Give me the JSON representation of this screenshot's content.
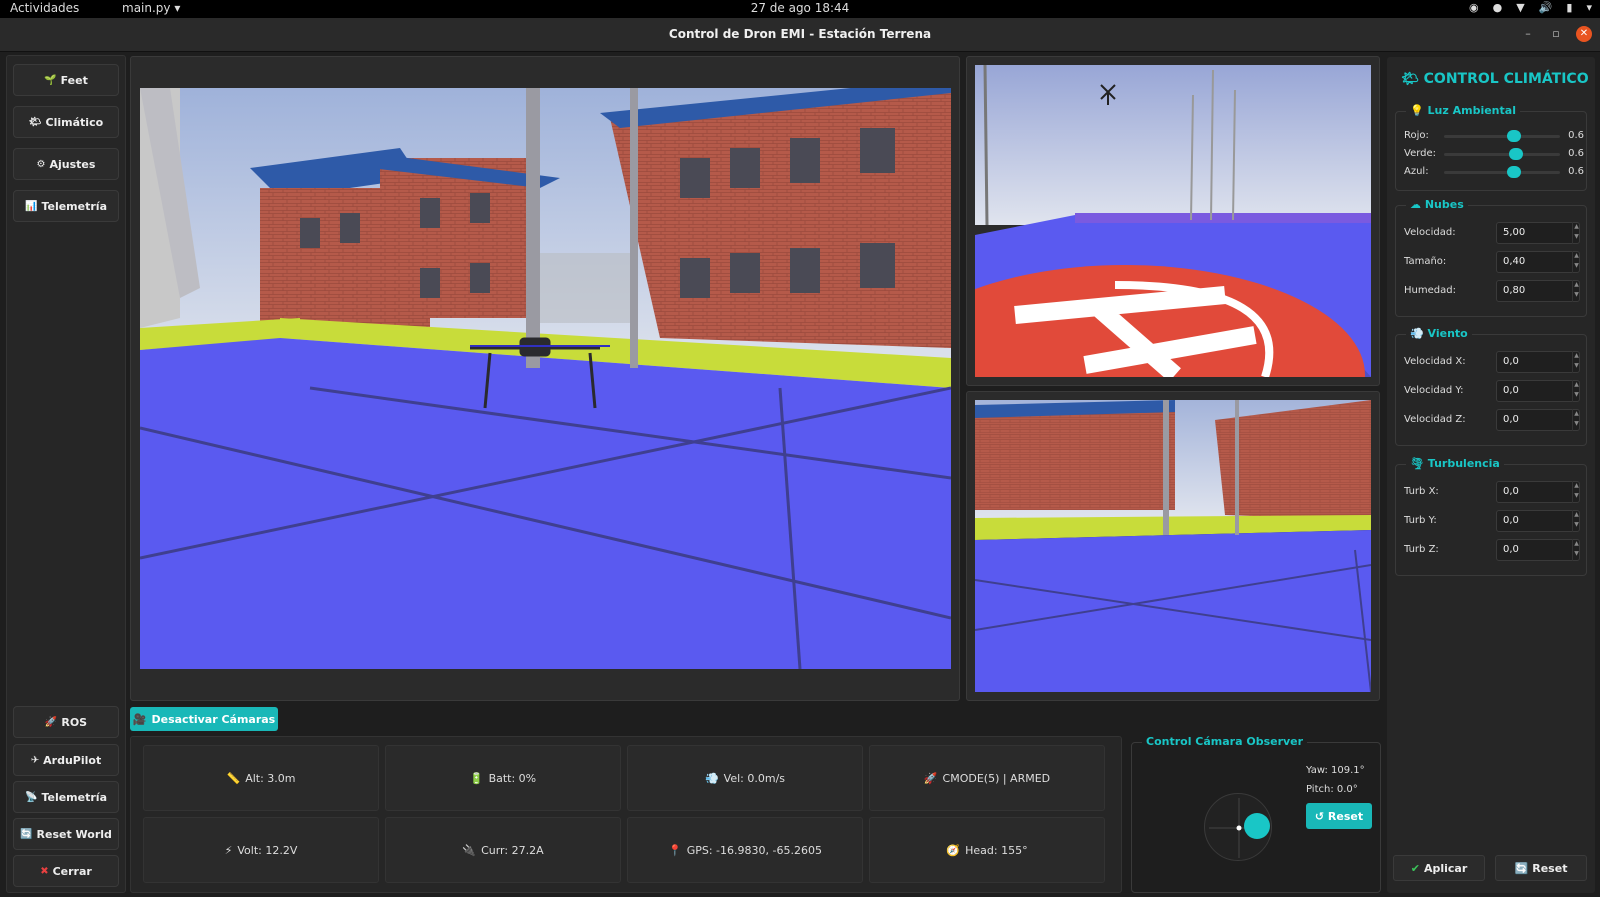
{
  "system_bar": {
    "activities": "Actividades",
    "app_menu": "main.py ▾",
    "clock": "27 de ago  18:44"
  },
  "window": {
    "title": "Control de Dron EMI - Estación Terrena"
  },
  "left_nav": {
    "top": [
      {
        "icon": "leaf-icon",
        "glyph": "🌱",
        "label": "Feet"
      },
      {
        "icon": "weather-icon",
        "glyph": "🌤",
        "label": "Climático"
      },
      {
        "icon": "gear-icon",
        "glyph": "⚙",
        "label": "Ajustes"
      },
      {
        "icon": "chart-icon",
        "glyph": "📊",
        "label": "Telemetría"
      }
    ],
    "bottom": [
      {
        "icon": "rocket-icon",
        "glyph": "🚀",
        "label": "ROS"
      },
      {
        "icon": "plane-icon",
        "glyph": "✈",
        "label": "ArduPilot"
      },
      {
        "icon": "satellite-icon",
        "glyph": "📡",
        "label": "Telemetría"
      },
      {
        "icon": "reset-icon",
        "glyph": "🔄",
        "label": "Reset World"
      },
      {
        "icon": "close-icon",
        "glyph": "✖",
        "label": "Cerrar"
      }
    ]
  },
  "cameras": {
    "toggle_label": "Desactivar Cámaras"
  },
  "telemetry": {
    "row1": [
      {
        "icon": "altitude-icon",
        "glyph": "📏",
        "text": "Alt: 3.0m"
      },
      {
        "icon": "battery-icon",
        "glyph": "🔋",
        "text": "Batt: 0%"
      },
      {
        "icon": "wind-icon",
        "glyph": "💨",
        "text": "Vel: 0.0m/s"
      },
      {
        "icon": "mode-icon",
        "glyph": "🚀",
        "text": "CMODE(5) | ARMED"
      }
    ],
    "row2": [
      {
        "icon": "bolt-icon",
        "glyph": "⚡",
        "text": "Volt: 12.2V"
      },
      {
        "icon": "plug-icon",
        "glyph": "🔌",
        "text": "Curr: 27.2A"
      },
      {
        "icon": "pin-icon",
        "glyph": "📍",
        "text": "GPS: -16.9830, -65.2605"
      },
      {
        "icon": "compass-icon",
        "glyph": "🧭",
        "text": "Head: 155°"
      }
    ]
  },
  "observer": {
    "title": "Control Cámara Observer",
    "yaw": "Yaw: 109.1°",
    "pitch": "Pitch: 0.0°",
    "reset_label": "↺ Reset"
  },
  "climate": {
    "title": "CONTROL CLIMÁTICO",
    "light": {
      "title": "Luz Ambiental",
      "sliders": [
        {
          "label": "Rojo:",
          "value": "0.6",
          "fraction": 0.6
        },
        {
          "label": "Verde:",
          "value": "0.6",
          "fraction": 0.62
        },
        {
          "label": "Azul:",
          "value": "0.6",
          "fraction": 0.6
        }
      ]
    },
    "clouds": {
      "title": "Nubes",
      "fields": [
        {
          "label": "Velocidad:",
          "value": "5,00"
        },
        {
          "label": "Tamaño:",
          "value": "0,40"
        },
        {
          "label": "Humedad:",
          "value": "0,80"
        }
      ]
    },
    "wind": {
      "title": "Viento",
      "fields": [
        {
          "label": "Velocidad X:",
          "value": "0,0"
        },
        {
          "label": "Velocidad Y:",
          "value": "0,0"
        },
        {
          "label": "Velocidad Z:",
          "value": "0,0"
        }
      ]
    },
    "turbulence": {
      "title": "Turbulencia",
      "fields": [
        {
          "label": "Turb X:",
          "value": "0,0"
        },
        {
          "label": "Turb Y:",
          "value": "0,0"
        },
        {
          "label": "Turb Z:",
          "value": "0,0"
        }
      ]
    },
    "apply_label": "Aplicar",
    "reset_label": "Reset"
  },
  "colors": {
    "accent": "#19c6c6",
    "ground": "#5a5af0",
    "close": "#e95420"
  }
}
